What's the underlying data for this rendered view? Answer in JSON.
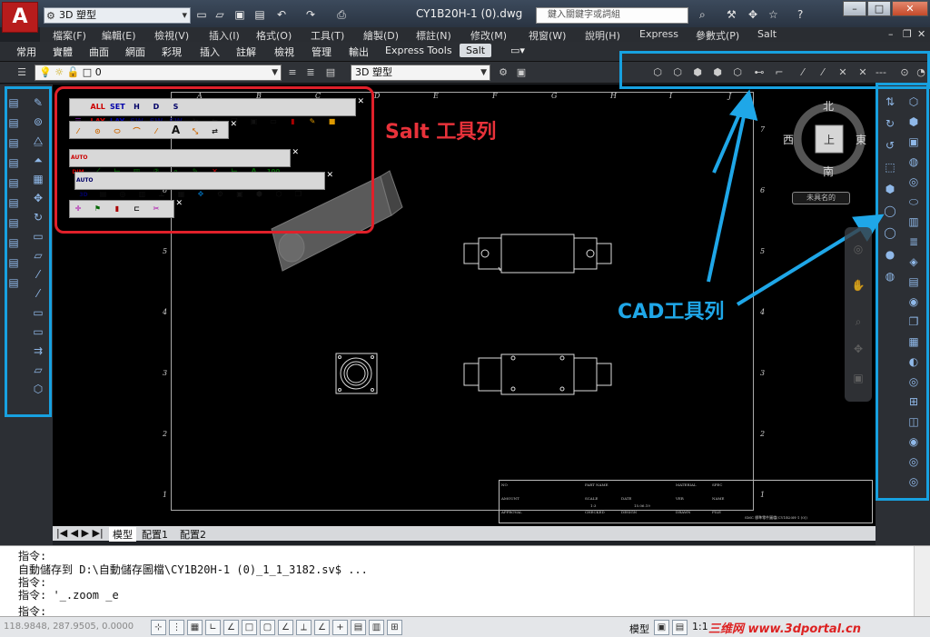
{
  "app": {
    "logo_text": "A",
    "workspace": "3D 塑型",
    "doc_title": "CY1B20H-1 (0).dwg",
    "search_placeholder": "鍵入關鍵字或詞組"
  },
  "menus": [
    "檔案(F)",
    "編輯(E)",
    "檢視(V)",
    "插入(I)",
    "格式(O)",
    "工具(T)",
    "繪製(D)",
    "標註(N)",
    "修改(M)",
    "視窗(W)",
    "說明(H)",
    "Express",
    "參數式(P)",
    "Salt"
  ],
  "ribbon_tabs": [
    "常用",
    "實體",
    "曲面",
    "網面",
    "彩現",
    "插入",
    "註解",
    "檢視",
    "管理",
    "輸出",
    "Express Tools",
    "Salt"
  ],
  "layer_combo": "0",
  "visual_style_combo": "3D 塑型",
  "sheet": {
    "columns": [
      "A",
      "B",
      "C",
      "D",
      "E",
      "F",
      "G",
      "H",
      "I",
      "J"
    ],
    "rows": [
      "7",
      "6",
      "5",
      "4",
      "3",
      "2",
      "1"
    ]
  },
  "titleblock": {
    "cells": [
      "NO",
      "PART NAME",
      "MATERIAL",
      "SPEC",
      "AMOUNT",
      "SCALE",
      "1:3",
      "DATE",
      "15.06.19",
      "VER",
      "NAME",
      "APPROVAL",
      "CHECKED",
      "DESIGN",
      "DRAWN",
      "FILE",
      "SMC 標準零件圖檔(CY1B20H-1 (0))"
    ]
  },
  "compass": {
    "north": "北",
    "south": "南",
    "east": "東",
    "west": "西",
    "center": "上"
  },
  "ucs_label": "未具名的",
  "annotations": {
    "salt": "Salt 工具列",
    "cad": "CAD工具列"
  },
  "salt_toolbar_1": [
    "ALL LAY",
    "SET LAY",
    "H SW",
    "D SW",
    "S SW"
  ],
  "salt_toolbar_2": [
    "A"
  ],
  "salt_toolbar_3": [
    "AUTO DIM",
    "100"
  ],
  "salt_toolbar_4": [
    "AUTO 3D"
  ],
  "layout_tabs": [
    "模型",
    "配置1",
    "配置2"
  ],
  "command_lines": [
    "指令:",
    "自動儲存到 D:\\自動儲存圖檔\\CY1B20H-1 (0)_1_1_3182.sv$ ...",
    "指令:",
    "指令: '_.zoom _e"
  ],
  "command_prompt": "指令:",
  "status": {
    "coords": "118.9848, 287.9505, 0.0000",
    "model": "模型",
    "scale": "1:1",
    "watermark": "三维网 www.3dportal.cn"
  },
  "colors": {
    "highlight_blue": "#17a1e0",
    "highlight_red": "#e0202a"
  }
}
